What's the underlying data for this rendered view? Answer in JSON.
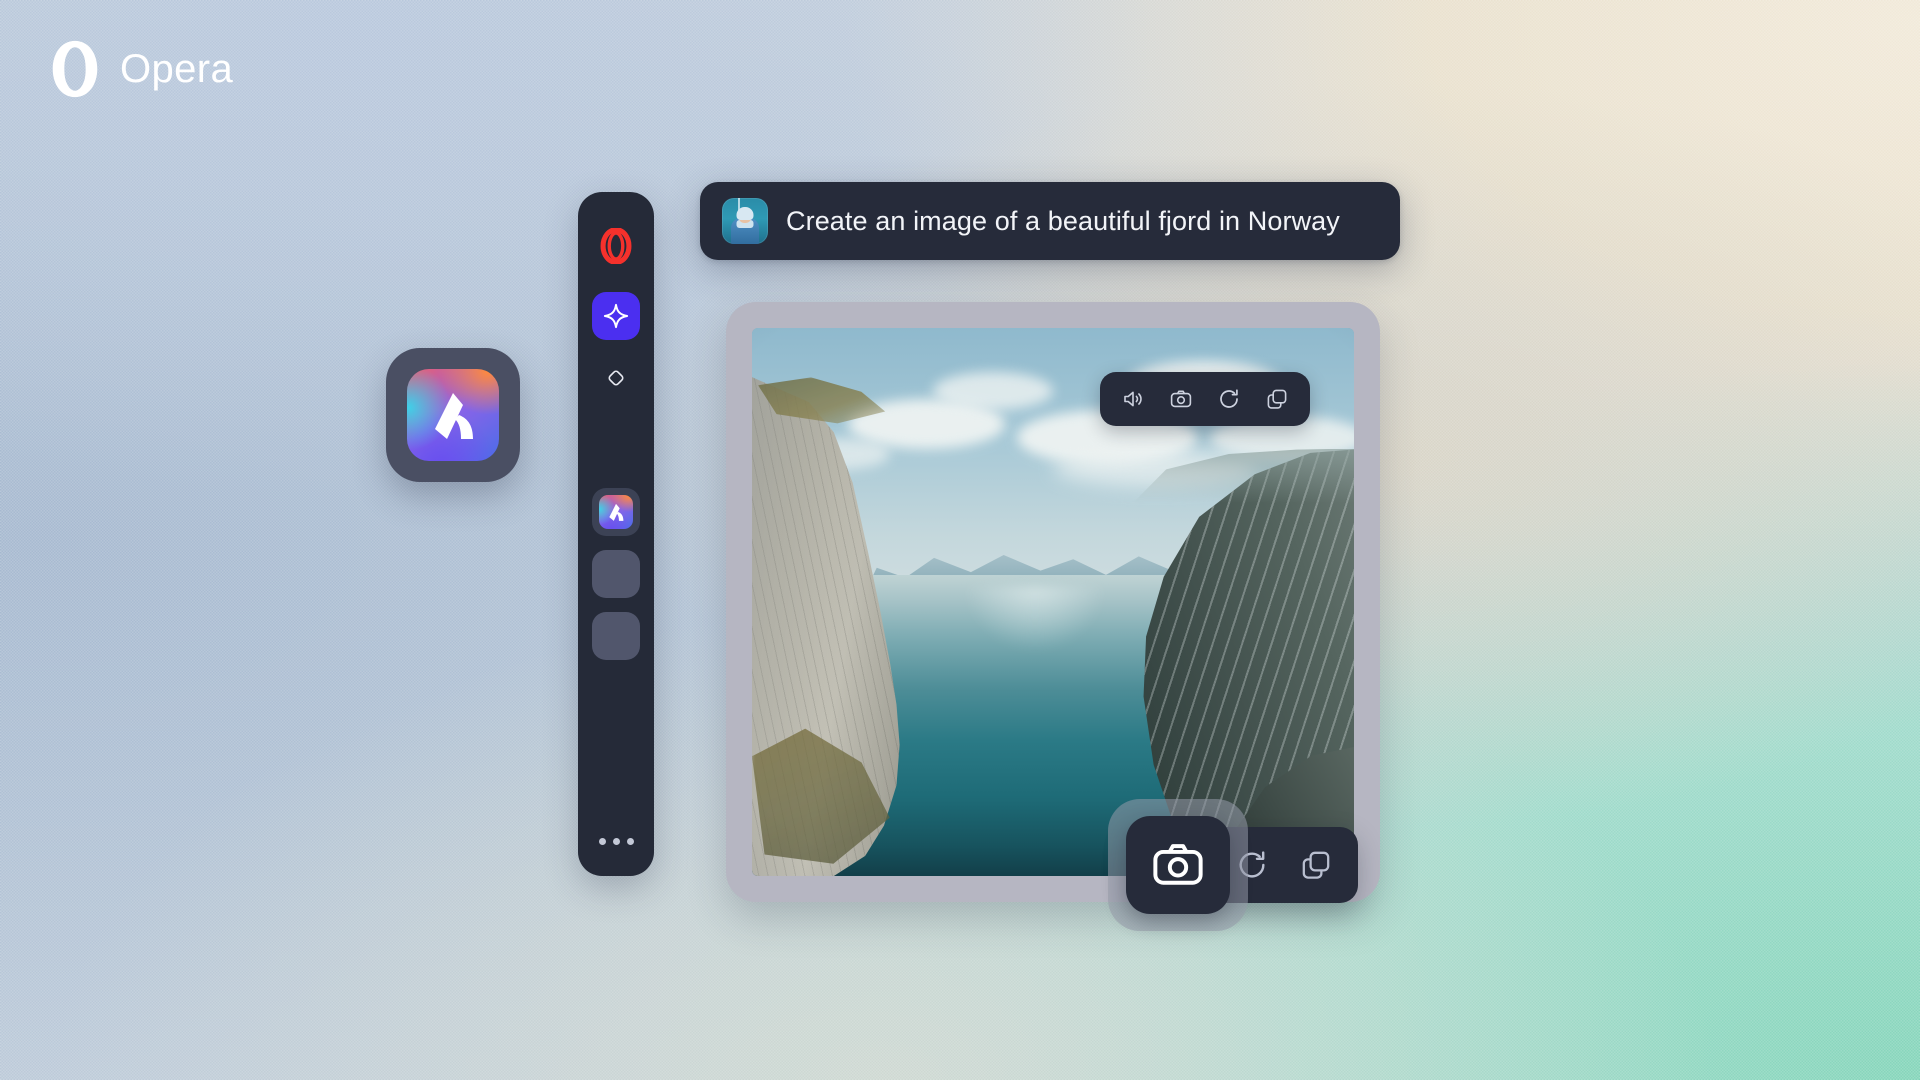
{
  "brand": {
    "name": "Opera",
    "logo_icon": "opera-o-logo-icon",
    "logo_color": "#ffffff"
  },
  "background": {
    "description": "soft mesh gradient backdrop with film grain",
    "colors": {
      "left_blue": "#b3c7dc",
      "top_right_cream": "#ece5d8",
      "bottom_right_mint": "#9adcc5",
      "center_haze": "#d3dcd6"
    }
  },
  "prompt": {
    "text": "Create an image of a beautiful fjord in Norway",
    "avatar_icon": "user-avatar",
    "avatar_description": "person in blue winter jacket and knit hat on teal background",
    "bubble_color": "#262b3a",
    "text_color": "#f2f4f8"
  },
  "aria_app_icon": {
    "name": "Aria",
    "icon": "aria-gradient-app-icon",
    "frame_color": "#4a4f63",
    "gradient_colors": [
      "#ff8a3d",
      "#3fd0e8",
      "#6a4df0",
      "#ef5f6b"
    ]
  },
  "sidebar": {
    "background": "#252a38",
    "items": [
      {
        "name": "opera-logo",
        "icon": "opera-o-logo-icon",
        "label": "Opera",
        "active": false,
        "color": "#f5312c"
      },
      {
        "name": "aria-sparkle",
        "icon": "sparkle-star-icon",
        "label": "Aria AI",
        "active": true,
        "color": "#4b2ff0"
      },
      {
        "name": "diamond",
        "icon": "diamond-outline-icon",
        "label": "Diamond",
        "active": false,
        "color": "#e6e8f0"
      },
      {
        "name": "aria-app",
        "icon": "aria-gradient-app-icon",
        "label": "Aria App",
        "active": true,
        "color": "#3c4255"
      },
      {
        "name": "placeholder-1",
        "icon": "empty-tile-icon",
        "label": "",
        "active": false,
        "color": "#51566c"
      },
      {
        "name": "placeholder-2",
        "icon": "empty-tile-icon",
        "label": "",
        "active": false,
        "color": "#51566c"
      }
    ],
    "more_button": {
      "name": "more-options",
      "icon": "ellipsis-icon",
      "label": "More"
    }
  },
  "image_card": {
    "frame_color": "#b6b6c2",
    "alt": "Aerial view of a Norwegian fjord with steep gray cliff on the left, deep teal water and dark mountains on the right under a cloudy pale blue sky",
    "scene": {
      "sky": "#a6c8d6",
      "clouds": "#eef3f2",
      "water": "#2b7a86",
      "left_cliff": "#c5c3b8",
      "right_mountain": "#44534f"
    }
  },
  "image_toolbar": {
    "buttons": [
      {
        "name": "read-aloud-button",
        "icon": "speaker-volume-icon",
        "label": "Read aloud"
      },
      {
        "name": "screenshot-button",
        "icon": "camera-icon",
        "label": "Screenshot"
      },
      {
        "name": "regenerate-button",
        "icon": "refresh-circular-arrow-icon",
        "label": "Regenerate"
      },
      {
        "name": "copy-button",
        "icon": "copy-duplicate-icon",
        "label": "Copy"
      }
    ]
  },
  "action_bar": {
    "capture": {
      "name": "capture-button",
      "icon": "camera-icon",
      "label": "Capture",
      "highlighted": true
    },
    "buttons": [
      {
        "name": "regenerate-button",
        "icon": "refresh-circular-arrow-icon",
        "label": "Regenerate"
      },
      {
        "name": "copy-button",
        "icon": "copy-duplicate-icon",
        "label": "Copy"
      }
    ]
  }
}
